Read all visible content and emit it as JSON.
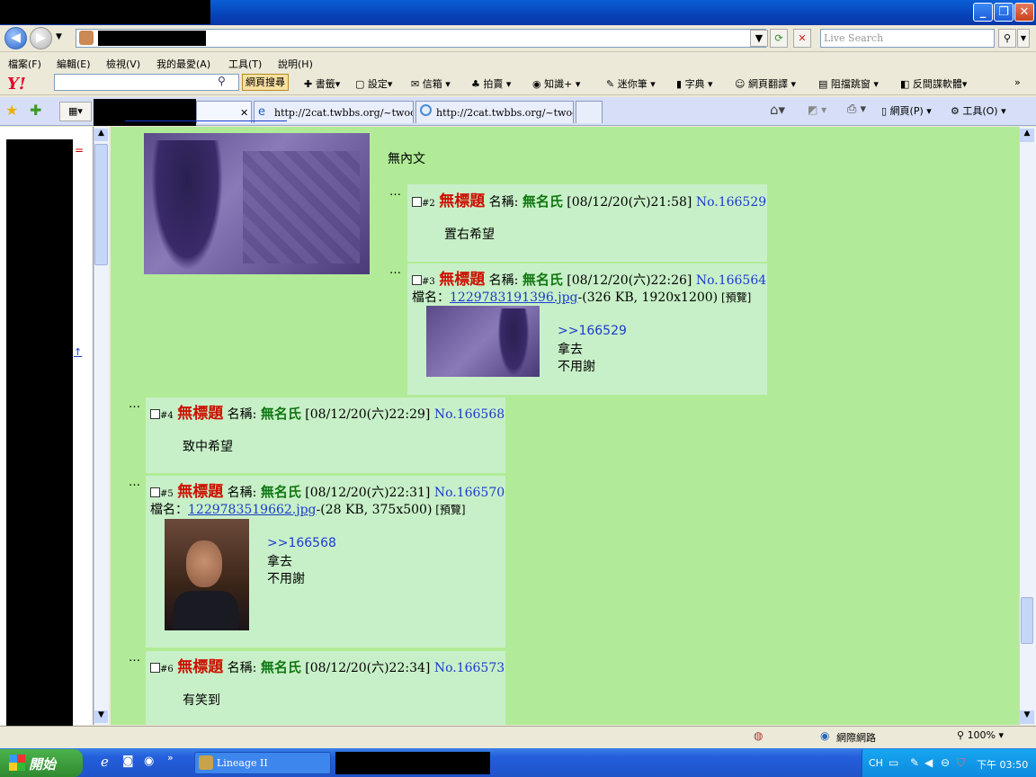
{
  "window": {
    "minimize": "_",
    "maximize": "❐",
    "close": "✕"
  },
  "address": {
    "live_search_placeholder": "Live Search"
  },
  "menu": [
    "檔案(F)",
    "編輯(E)",
    "檢視(V)",
    "我的最愛(A)",
    "工具(T)",
    "說明(H)"
  ],
  "yahoo_toolbar": {
    "logo": "Y!",
    "search_button": "網頁搜尋",
    "tools": [
      "書籤",
      "設定",
      "信箱",
      "拍賣",
      "知識+",
      "迷你筆",
      "字典",
      "網頁翻譯",
      "阻擋跳窗",
      "反間諜軟體"
    ]
  },
  "tabs": [
    {
      "label": "http://2cat.twbbs.org/~twocat/..."
    },
    {
      "label": "http://2cat.twbbs.org/~twocat/..."
    }
  ],
  "command_bar": {
    "page": "網頁(P)",
    "tools": "工具(O)"
  },
  "thread": {
    "op_body": "無內文",
    "posts": [
      {
        "num": "#2",
        "title": "無標題",
        "name_label": "名稱:",
        "name": "無名氏",
        "date": "[08/12/20(六)21:58]",
        "no": "No.166529",
        "body": "置右希望"
      },
      {
        "num": "#3",
        "title": "無標題",
        "name_label": "名稱:",
        "name": "無名氏",
        "date": "[08/12/20(六)22:26]",
        "no": "No.166564",
        "file_label": "檔名：",
        "file": "1229783191396.jpg",
        "file_meta": "-(326 KB, 1920x1200)",
        "preview": "[預覽]",
        "quote": ">>166529",
        "line1": "拿去",
        "line2": "不用謝"
      },
      {
        "num": "#4",
        "title": "無標題",
        "name_label": "名稱:",
        "name": "無名氏",
        "date": "[08/12/20(六)22:29]",
        "no": "No.166568",
        "body": "致中希望"
      },
      {
        "num": "#5",
        "title": "無標題",
        "name_label": "名稱:",
        "name": "無名氏",
        "date": "[08/12/20(六)22:31]",
        "no": "No.166570",
        "file_label": "檔名：",
        "file": "1229783519662.jpg",
        "file_meta": "-(28 KB, 375x500)",
        "preview": "[預覽]",
        "quote": ">>166568",
        "line1": "拿去",
        "line2": "不用謝"
      },
      {
        "num": "#6",
        "title": "無標題",
        "name_label": "名稱:",
        "name": "無名氏",
        "date": "[08/12/20(六)22:34]",
        "no": "No.166573",
        "body": "有笑到"
      }
    ]
  },
  "status": {
    "zone": "網際網路",
    "zoom": "100%"
  },
  "taskbar": {
    "start": "開始",
    "task1": "Lineage II",
    "lang": "CH",
    "clock": "下午 03:50"
  },
  "colors": {
    "page_bg": "#b1eb97",
    "reply_bg": "#c8f0c8",
    "title_red": "#cc1100",
    "name_green": "#117711",
    "link_blue": "#1a3ccc"
  }
}
